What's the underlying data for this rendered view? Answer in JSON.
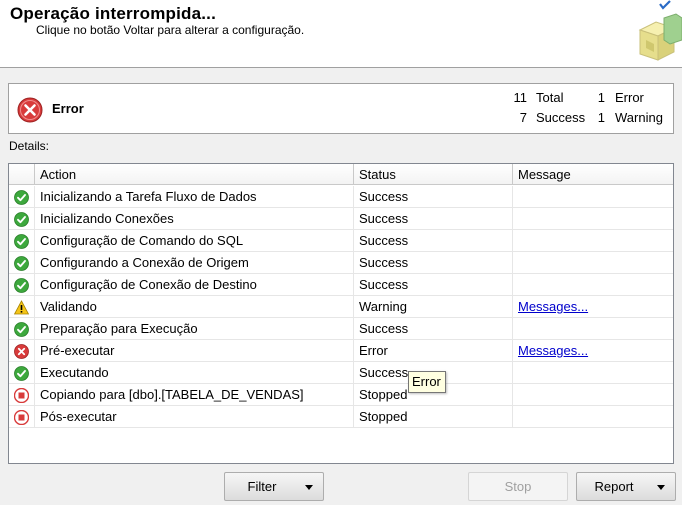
{
  "header": {
    "title": "Operação interrompida...",
    "subtitle": "Clique no botão Voltar para alterar a configuração."
  },
  "summary": {
    "status": "Error",
    "total_count": "11",
    "total_label": "Total",
    "success_count": "7",
    "success_label": "Success",
    "error_count": "1",
    "error_label": "Error",
    "warning_count": "1",
    "warning_label": "Warning"
  },
  "details_label": "Details:",
  "table": {
    "columns": [
      "Action",
      "Status",
      "Message"
    ],
    "rows": [
      {
        "icon": "success-icon",
        "action": "Inicializando a Tarefa Fluxo de Dados",
        "status": "Success",
        "message": ""
      },
      {
        "icon": "success-icon",
        "action": "Inicializando Conexões",
        "status": "Success",
        "message": ""
      },
      {
        "icon": "success-icon",
        "action": "Configuração de Comando do SQL",
        "status": "Success",
        "message": ""
      },
      {
        "icon": "success-icon",
        "action": "Configurando a Conexão de Origem",
        "status": "Success",
        "message": ""
      },
      {
        "icon": "success-icon",
        "action": "Configuração de Conexão de Destino",
        "status": "Success",
        "message": ""
      },
      {
        "icon": "warning-icon",
        "action": "Validando",
        "status": "Warning",
        "message": "Messages..."
      },
      {
        "icon": "success-icon",
        "action": "Preparação para Execução",
        "status": "Success",
        "message": ""
      },
      {
        "icon": "error-icon",
        "action": "Pré-executar",
        "status": "Error",
        "message": "Messages..."
      },
      {
        "icon": "success-icon",
        "action": "Executando",
        "status": "Success",
        "message": ""
      },
      {
        "icon": "stopped-icon",
        "action": "Copiando para [dbo].[TABELA_DE_VENDAS]",
        "status": "Stopped",
        "message": ""
      },
      {
        "icon": "stopped-icon",
        "action": "Pós-executar",
        "status": "Stopped",
        "message": ""
      }
    ]
  },
  "tooltip": "Error",
  "buttons": {
    "filter": "Filter",
    "stop": "Stop",
    "report": "Report"
  },
  "colors": {
    "success": "#3da83d",
    "error": "#d83b3b",
    "warning": "#f5c518",
    "stopped": "#d83b3b",
    "link": "#0000cc"
  }
}
